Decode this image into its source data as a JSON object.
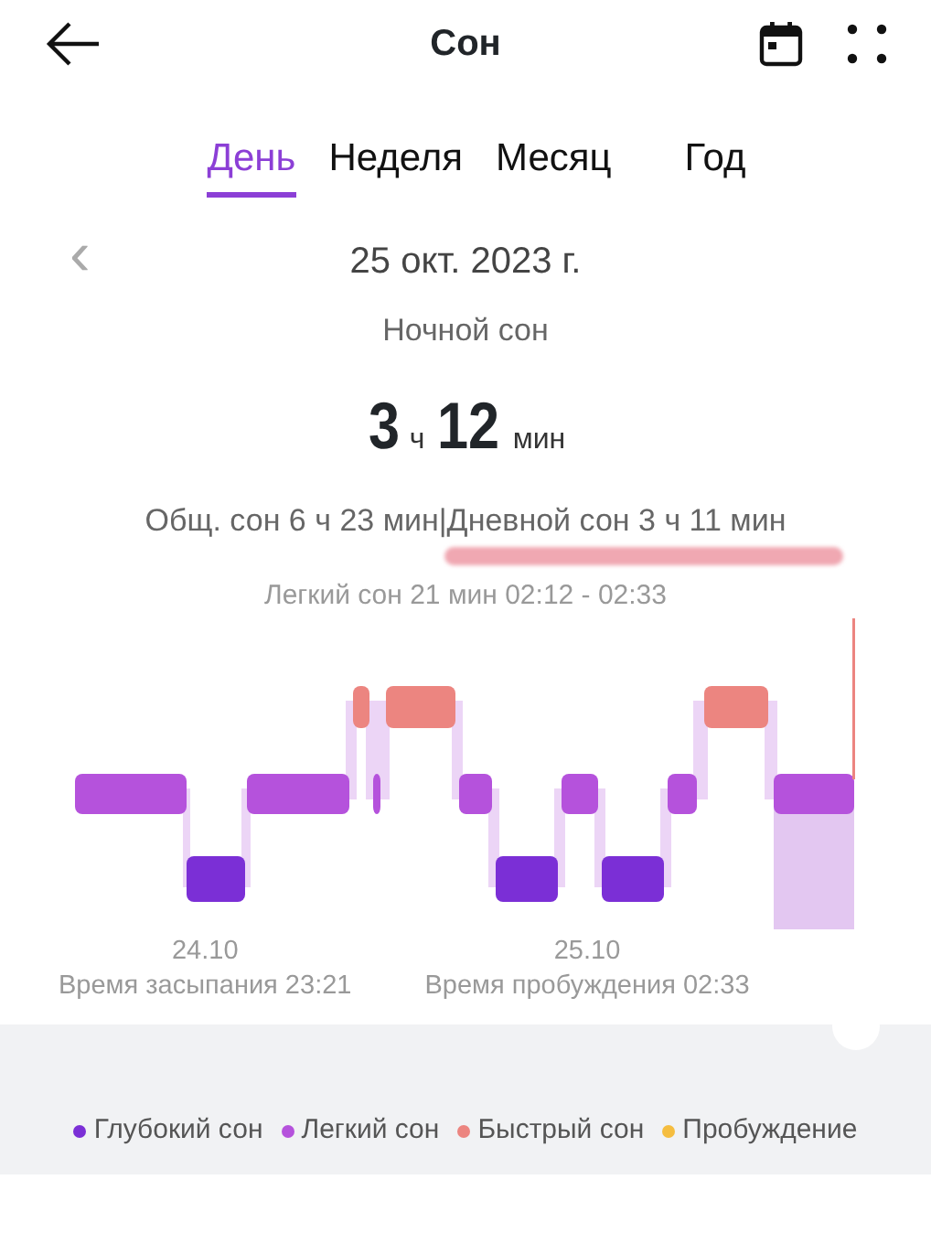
{
  "header": {
    "title": "Сон"
  },
  "tabs": [
    {
      "label": "День",
      "selected": true
    },
    {
      "label": "Неделя",
      "selected": false
    },
    {
      "label": "Месяц",
      "selected": false
    },
    {
      "label": "Год",
      "selected": false
    }
  ],
  "date_nav": {
    "prev": "‹",
    "date": "25 окт. 2023 г."
  },
  "summary": {
    "label": "Ночной сон",
    "hours": "3",
    "hours_unit": "ч",
    "minutes": "12",
    "minutes_unit": "мин",
    "totals": "Общ. сон 6 ч 23 мин|Дневной сон 3 ч 11 мин",
    "selected_segment": "Легкий сон 21 мин 02:12 - 02:33"
  },
  "chart": {
    "start_date": "24.10",
    "start_label": "Время засыпания 23:21",
    "end_date": "25.10",
    "end_label": "Время пробуждения 02:33"
  },
  "legend": [
    {
      "label": "Глубокий сон",
      "color": "#7b2fd6"
    },
    {
      "label": "Легкий сон",
      "color": "#b552dc"
    },
    {
      "label": "Быстрый сон",
      "color": "#ec8580"
    },
    {
      "label": "Пробуждение",
      "color": "#f5bd3f"
    }
  ]
}
